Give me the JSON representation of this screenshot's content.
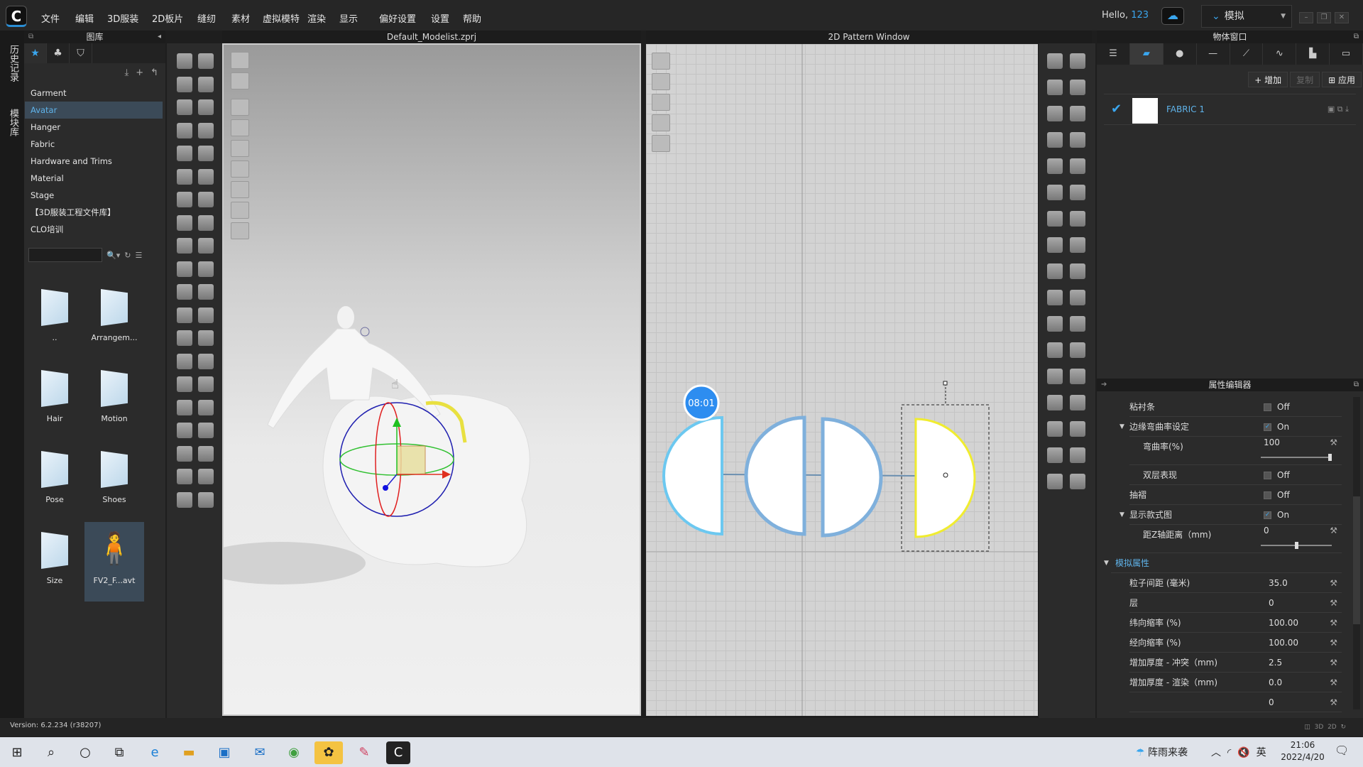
{
  "menu": [
    "文件",
    "编辑",
    "3D服装",
    "2D板片",
    "缝纫",
    "素材",
    "虚拟模特",
    "渲染",
    "显示",
    "偏好设置",
    "设置",
    "帮助"
  ],
  "header": {
    "hello": "Hello,",
    "user": "123",
    "mode": "模拟"
  },
  "side_tabs": [
    "历史记录",
    "模块库"
  ],
  "library": {
    "title": "图库",
    "categories": [
      "Garment",
      "Avatar",
      "Hanger",
      "Fabric",
      "Hardware and Trims",
      "Material",
      "Stage",
      "【3D服装工程文件库】",
      "CLO培训"
    ],
    "selected": "Avatar",
    "search_value": "",
    "items": [
      {
        "label": "..",
        "type": "folder"
      },
      {
        "label": "Arrangem...",
        "type": "folder"
      },
      {
        "label": "Hair",
        "type": "folder"
      },
      {
        "label": "Motion",
        "type": "folder"
      },
      {
        "label": "Pose",
        "type": "folder"
      },
      {
        "label": "Shoes",
        "type": "folder"
      },
      {
        "label": "Size",
        "type": "folder"
      },
      {
        "label": "FV2_F...avt",
        "type": "avatar"
      }
    ]
  },
  "view3d": {
    "title": "Default_Modelist.zprj"
  },
  "view2d": {
    "title": "2D Pattern Window",
    "timer": "08:01"
  },
  "object_window": {
    "title": "物体窗口",
    "buttons": [
      "增加",
      "复制",
      "应用"
    ],
    "fabric": "FABRIC 1"
  },
  "property_editor": {
    "title": "属性编辑器",
    "rows": [
      {
        "label": "粘衬条",
        "value": "Off",
        "type": "check",
        "checked": false
      },
      {
        "label": "边缘弯曲率设定",
        "value": "On",
        "type": "check",
        "checked": true,
        "expand": true
      },
      {
        "label": "弯曲率(%)",
        "value": "100",
        "type": "slider",
        "level": 100,
        "sub": true
      },
      {
        "label": "双层表现",
        "value": "Off",
        "type": "check",
        "checked": false,
        "sub": true
      },
      {
        "label": "抽褶",
        "value": "Off",
        "type": "check",
        "checked": false
      },
      {
        "label": "显示款式图",
        "value": "On",
        "type": "check",
        "checked": true,
        "expand": true
      },
      {
        "label": "距Z轴距离（mm)",
        "value": "0",
        "type": "slider",
        "level": 50,
        "sub": true
      }
    ],
    "section": "模拟属性",
    "sim_rows": [
      {
        "label": "粒子间距 (毫米)",
        "value": "35.0"
      },
      {
        "label": "层",
        "value": "0"
      },
      {
        "label": "纬向缩率 (%)",
        "value": "100.00"
      },
      {
        "label": "经向缩率 (%)",
        "value": "100.00"
      },
      {
        "label": "增加厚度 - 冲突（mm)",
        "value": "2.5"
      },
      {
        "label": "增加厚度 - 渲染（mm)",
        "value": "0.0"
      },
      {
        "label": "",
        "value": "0"
      }
    ]
  },
  "status": {
    "version": "Version: 6.2.234 (r38207)",
    "view_buttons": [
      "3D",
      "2D"
    ]
  },
  "taskbar": {
    "weather": "阵雨来袭",
    "ime": "英",
    "time": "21:06",
    "date": "2022/4/20"
  },
  "colors": {
    "accent": "#3aa6ee",
    "selected_outline": "#f4f040",
    "piece_outline": "#7fb0dc"
  }
}
